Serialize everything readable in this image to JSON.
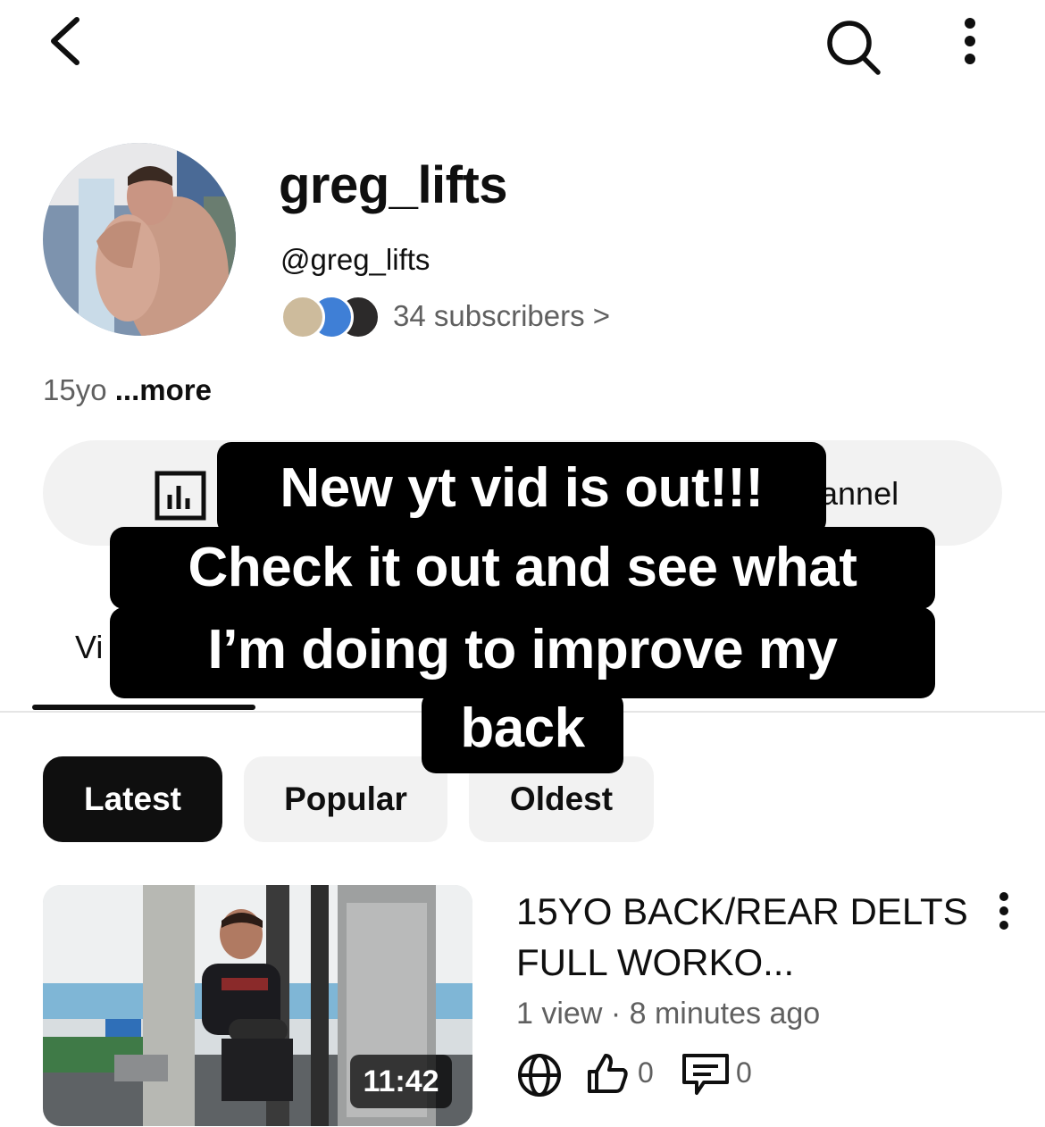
{
  "header": {
    "back_icon": "chevron-left-icon",
    "search_icon": "search-icon",
    "more_icon": "more-vert-icon"
  },
  "channel": {
    "name": "greg_lifts",
    "handle": "@greg_lifts",
    "subscribers": "34 subscribers >",
    "bio_text": "15yo ",
    "bio_more": "...more"
  },
  "manage_pill": {
    "icon": "analytics-icon",
    "label_fragment": "annel"
  },
  "tabs": {
    "active_fragment": "Vi"
  },
  "caption_overlay": {
    "line1": "New yt vid is out!!!",
    "line2": "Check it out and see what",
    "line3": "I’m doing to improve my",
    "line4": "back"
  },
  "chips": {
    "latest": "Latest",
    "popular": "Popular",
    "oldest": "Oldest"
  },
  "video": {
    "title": "15YO BACK/REAR DELTS FULL WORKO...",
    "meta": "1 view · 8 minutes ago",
    "duration": "11:42",
    "likes": "0",
    "comments": "0",
    "visibility_icon": "globe-icon",
    "like_icon": "thumbs-up-icon",
    "comment_icon": "comment-icon"
  },
  "colors": {
    "text_primary": "#0f0f0f",
    "text_secondary": "#606060",
    "chip_bg": "#f2f2f2",
    "chip_active_bg": "#0f0f0f",
    "caption_bg": "#000000"
  }
}
